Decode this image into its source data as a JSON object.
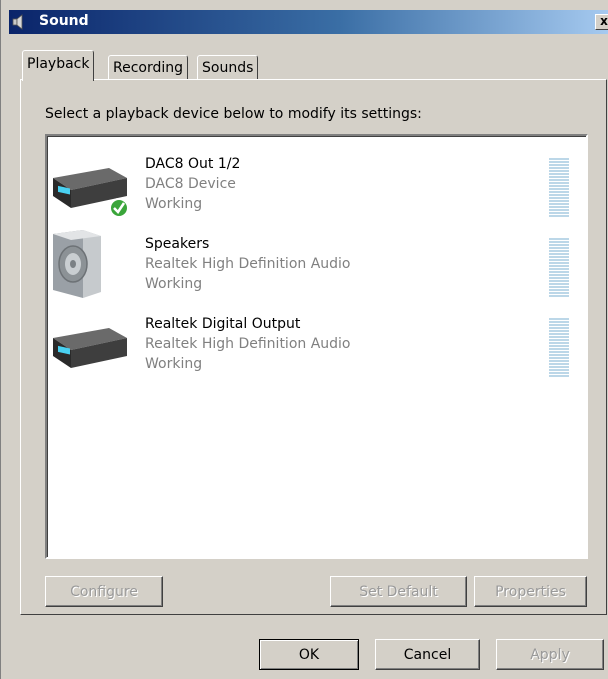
{
  "window": {
    "title": "Sound",
    "close_label": "x"
  },
  "tabs": [
    {
      "label": "Playback",
      "active": true
    },
    {
      "label": "Recording",
      "active": false
    },
    {
      "label": "Sounds",
      "active": false
    }
  ],
  "instruction": "Select a playback device below to modify its settings:",
  "devices": [
    {
      "name": "DAC8 Out 1/2",
      "description": "DAC8 Device",
      "status": "Working",
      "icon": "audio-receiver-icon",
      "is_default": true
    },
    {
      "name": "Speakers",
      "description": "Realtek High Definition Audio",
      "status": "Working",
      "icon": "speaker-icon",
      "is_default": false
    },
    {
      "name": "Realtek Digital Output",
      "description": "Realtek High Definition Audio",
      "status": "Working",
      "icon": "audio-receiver-icon",
      "is_default": false
    }
  ],
  "panel_buttons": {
    "configure": "Configure",
    "set_default": "Set Default",
    "properties": "Properties"
  },
  "dialog_buttons": {
    "ok": "OK",
    "cancel": "Cancel",
    "apply": "Apply"
  },
  "colors": {
    "meter": "#bcd7e8",
    "default_check": "#3aa53a",
    "title_bar": "#0a246a"
  }
}
